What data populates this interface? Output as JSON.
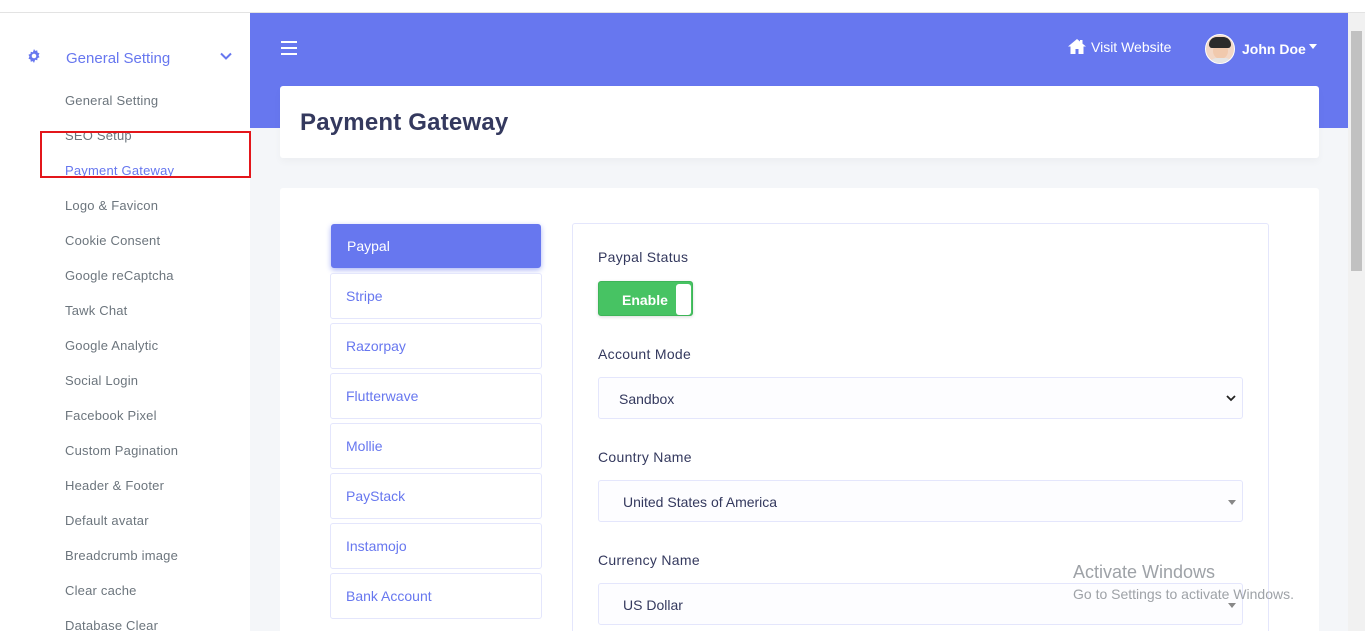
{
  "sidebar": {
    "parent": {
      "icon": "gear-icon",
      "label": "General Setting",
      "chevron": "chevron-down-icon"
    },
    "items": [
      {
        "label": "General Setting"
      },
      {
        "label": "SEO Setup"
      },
      {
        "label": "Payment Gateway",
        "active": true
      },
      {
        "label": "Logo & Favicon"
      },
      {
        "label": "Cookie Consent"
      },
      {
        "label": "Google reCaptcha"
      },
      {
        "label": "Tawk Chat"
      },
      {
        "label": "Google Analytic"
      },
      {
        "label": "Social Login"
      },
      {
        "label": "Facebook Pixel"
      },
      {
        "label": "Custom Pagination"
      },
      {
        "label": "Header & Footer"
      },
      {
        "label": "Default avatar"
      },
      {
        "label": "Breadcrumb image"
      },
      {
        "label": "Clear cache"
      },
      {
        "label": "Database Clear"
      }
    ]
  },
  "header": {
    "menu_icon": "hamburger-icon",
    "visit_website": {
      "icon": "home-icon",
      "label": "Visit Website"
    },
    "user": {
      "name": "John Doe"
    }
  },
  "page": {
    "title": "Payment Gateway"
  },
  "gateways": [
    {
      "label": "Paypal",
      "active": true
    },
    {
      "label": "Stripe"
    },
    {
      "label": "Razorpay"
    },
    {
      "label": "Flutterwave"
    },
    {
      "label": "Mollie"
    },
    {
      "label": "PayStack"
    },
    {
      "label": "Instamojo"
    },
    {
      "label": "Bank Account"
    }
  ],
  "form": {
    "status": {
      "label": "Paypal Status",
      "toggle_label": "Enable",
      "enabled": true
    },
    "account_mode": {
      "label": "Account Mode",
      "value": "Sandbox"
    },
    "country": {
      "label": "Country Name",
      "value": "United States of America"
    },
    "currency": {
      "label": "Currency Name",
      "value": "US Dollar"
    }
  },
  "watermark": {
    "line1": "Activate Windows",
    "line2": "Go to Settings to activate Windows."
  },
  "colors": {
    "primary": "#6777ef",
    "success": "#47c363",
    "highlight": "#e3161b"
  }
}
